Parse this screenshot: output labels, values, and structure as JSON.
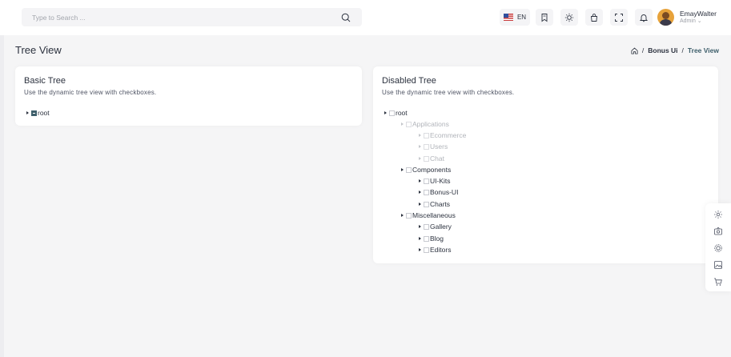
{
  "header": {
    "search": {
      "placeholder": "Type to Search ..."
    },
    "language": {
      "code": "EN",
      "flag": "us-flag"
    },
    "icons": [
      "bookmark-icon",
      "sun-icon",
      "bag-icon",
      "fullscreen-icon",
      "bell-icon"
    ],
    "profile": {
      "name": "EmayWalter",
      "role": "Admin ⌄"
    }
  },
  "page": {
    "title": "Tree View",
    "breadcrumb": {
      "separator": "/",
      "section": "Bonus Ui",
      "current": "Tree View"
    }
  },
  "basic_tree": {
    "title": "Basic Tree",
    "subtitle": "Use the dynamic tree view with checkboxes.",
    "root_label": "root"
  },
  "disabled_tree": {
    "title": "Disabled Tree",
    "subtitle": "Use the dynamic tree view with checkboxes.",
    "nodes": [
      {
        "label": "root",
        "level": 0,
        "disabled": false
      },
      {
        "label": "Applications",
        "level": 1,
        "disabled": true
      },
      {
        "label": "Ecommerce",
        "level": 2,
        "disabled": true
      },
      {
        "label": "Users",
        "level": 2,
        "disabled": true
      },
      {
        "label": "Chat",
        "level": 2,
        "disabled": true
      },
      {
        "label": "Components",
        "level": 1,
        "disabled": false
      },
      {
        "label": "UI-Kits",
        "level": 2,
        "disabled": false
      },
      {
        "label": "Bonus-UI",
        "level": 2,
        "disabled": false
      },
      {
        "label": "Charts",
        "level": 2,
        "disabled": false
      },
      {
        "label": "Miscellaneous",
        "level": 1,
        "disabled": false
      },
      {
        "label": "Gallery",
        "level": 2,
        "disabled": false
      },
      {
        "label": "Blog",
        "level": 2,
        "disabled": false
      },
      {
        "label": "Editors",
        "level": 2,
        "disabled": false
      }
    ]
  },
  "float_toolbar": {
    "icons": [
      "settings-icon",
      "camera-icon",
      "settings-alt-icon",
      "image-icon",
      "cart-icon"
    ]
  },
  "colors": {
    "accent": "#3e5f6b",
    "background": "#f5f5f6",
    "card": "#ffffff"
  }
}
